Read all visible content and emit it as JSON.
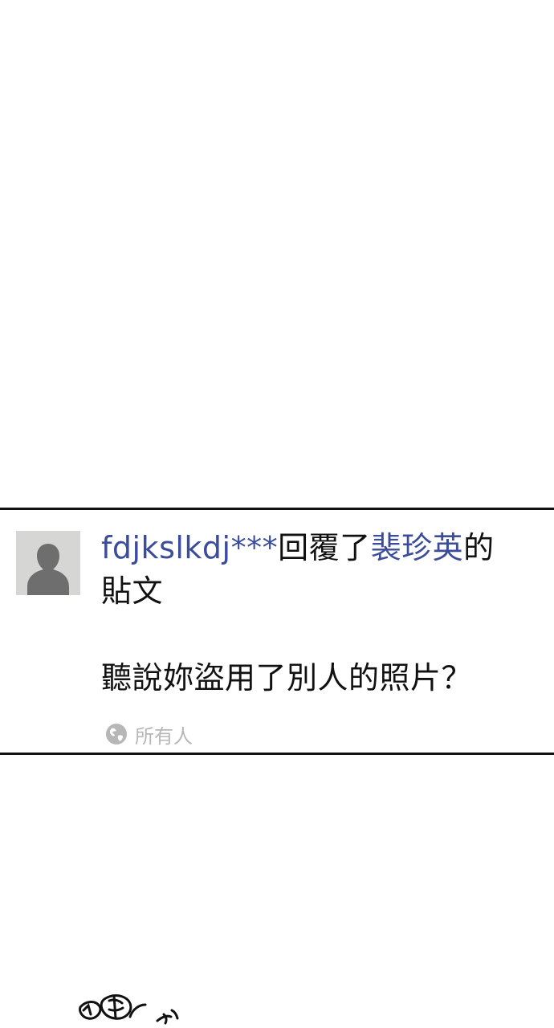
{
  "notification": {
    "username": "fdjkslkdj***",
    "action_text": "回覆了",
    "target_name": "裴珍英",
    "possessive": "的",
    "post_word": "貼文",
    "message": "聽說妳盜用了別人的照片？",
    "privacy_label": "所有人",
    "privacy_icon": "globe-icon",
    "link_color": "#3b4d9a",
    "privacy_color": "#b7b7b7"
  }
}
